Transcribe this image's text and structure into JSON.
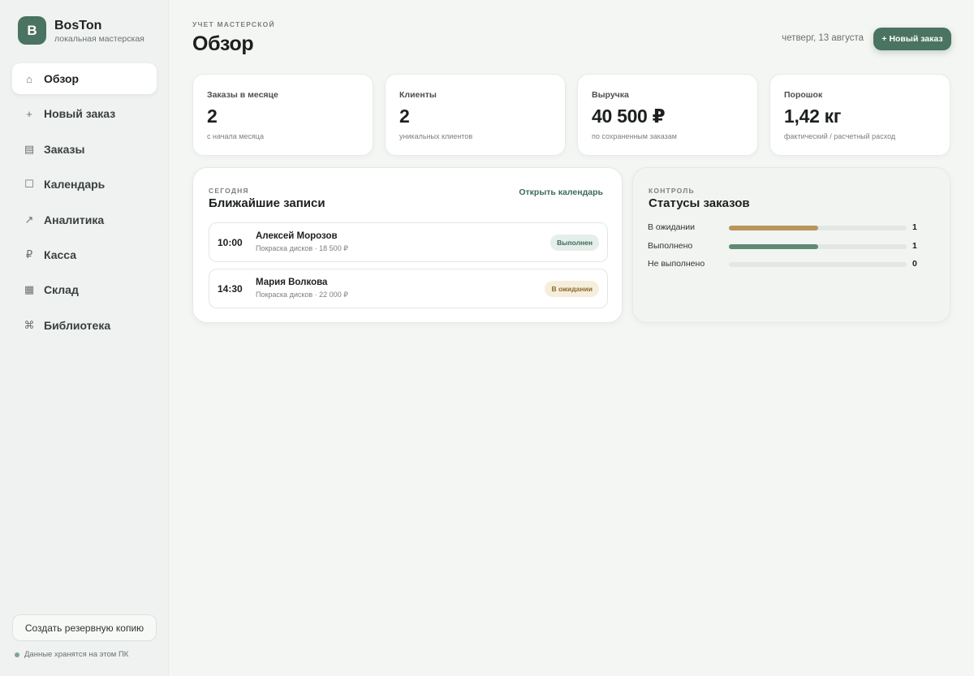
{
  "brand": {
    "logo_letter": "B",
    "name": "BosTon",
    "subtitle": "локальная мастерская"
  },
  "nav": [
    {
      "icon": "⌂",
      "icon_name": "home-icon",
      "label": "Обзор",
      "active": true
    },
    {
      "icon": "+",
      "icon_name": "plus-icon",
      "label": "Новый заказ",
      "active": false
    },
    {
      "icon": "▤",
      "icon_name": "list-icon",
      "label": "Заказы",
      "active": false
    },
    {
      "icon": "☐",
      "icon_name": "calendar-icon",
      "label": "Календарь",
      "active": false
    },
    {
      "icon": "↗",
      "icon_name": "trend-icon",
      "label": "Аналитика",
      "active": false
    },
    {
      "icon": "₽",
      "icon_name": "ruble-icon",
      "label": "Касса",
      "active": false
    },
    {
      "icon": "▦",
      "icon_name": "warehouse-icon",
      "label": "Склад",
      "active": false
    },
    {
      "icon": "⌘",
      "icon_name": "library-icon",
      "label": "Библиотека",
      "active": false
    }
  ],
  "sidebar_footer": {
    "backup_label": "Создать резервную копию",
    "storage_note": "Данные хранятся на этом ПК"
  },
  "header": {
    "eyebrow": "Учет мастерской",
    "title": "Обзор",
    "date": "четверг, 13 августа",
    "new_order_label": "+ Новый заказ"
  },
  "stats": [
    {
      "label": "Заказы в месяце",
      "value": "2",
      "note": "с начала месяца"
    },
    {
      "label": "Клиенты",
      "value": "2",
      "note": "уникальных клиентов"
    },
    {
      "label": "Выручка",
      "value": "40 500 ₽",
      "note": "по сохраненным заказам"
    },
    {
      "label": "Порошок",
      "value": "1,42 кг",
      "note": "фактический / расчетный расход"
    }
  ],
  "schedule": {
    "eyebrow": "Сегодня",
    "title": "Ближайшие записи",
    "link": "Открыть календарь",
    "items": [
      {
        "time": "10:00",
        "name": "Алексей Морозов",
        "service": "Покраска дисков · 18 500 ₽",
        "status": "Выполнен",
        "status_kind": "done"
      },
      {
        "time": "14:30",
        "name": "Мария Волкова",
        "service": "Покраска дисков · 22 000 ₽",
        "status": "В ожидании",
        "status_kind": "wait"
      }
    ]
  },
  "statuses": {
    "eyebrow": "Контроль",
    "title": "Статусы заказов",
    "max": 2,
    "items": [
      {
        "label": "В ожидании",
        "count": 1,
        "color": "#b8965c"
      },
      {
        "label": "Выполнено",
        "count": 1,
        "color": "#5f8a73"
      },
      {
        "label": "Не выполнено",
        "count": 0,
        "color": "#c9cfcb"
      }
    ]
  }
}
